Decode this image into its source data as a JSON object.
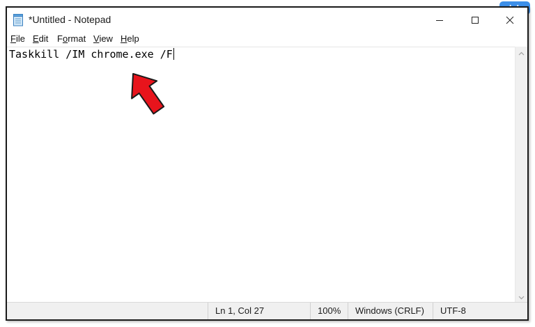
{
  "window": {
    "title": "*Untitled - Notepad",
    "icon": "notepad-icon",
    "controls": {
      "minimize": "minimize-icon",
      "maximize": "maximize-icon",
      "close": "close-icon"
    }
  },
  "menu": {
    "items": [
      {
        "label": "File",
        "accel": "F"
      },
      {
        "label": "Edit",
        "accel": "E"
      },
      {
        "label": "Format",
        "accel": "o"
      },
      {
        "label": "View",
        "accel": "V"
      },
      {
        "label": "Help",
        "accel": "H"
      }
    ]
  },
  "editor": {
    "content": "Taskkill /IM chrome.exe /F"
  },
  "statusbar": {
    "position": "Ln 1, Col 27",
    "zoom": "100%",
    "line_ending": "Windows (CRLF)",
    "encoding": "UTF-8"
  },
  "overlay": {
    "arrow_color": "#e8141c",
    "watermark": "alphr"
  },
  "colors": {
    "accent": "#3d8fe8",
    "arrow": "#e8141c"
  }
}
